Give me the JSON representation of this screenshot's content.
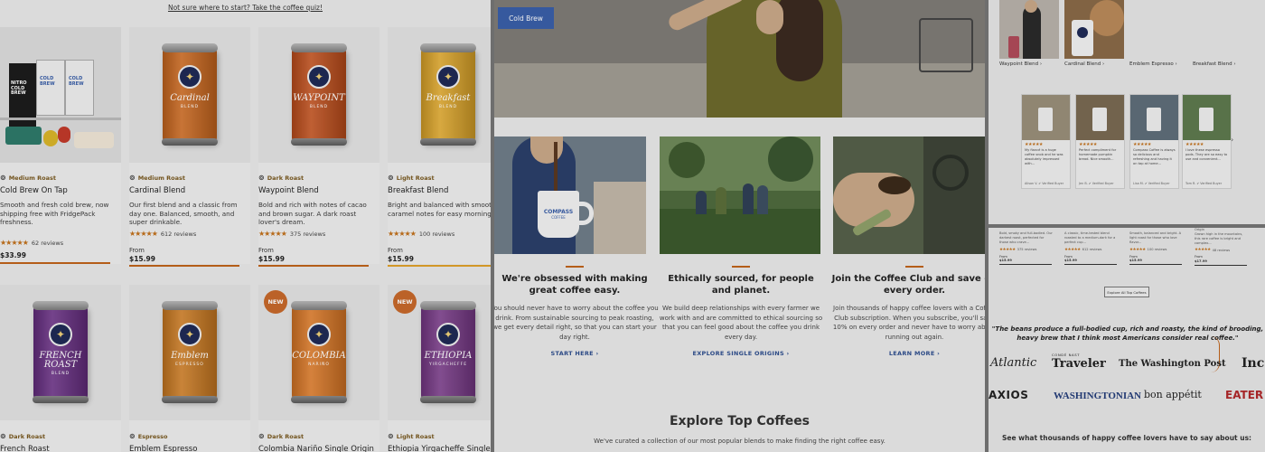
{
  "panel1": {
    "quiz_link": "Not sure where to start? Take the coffee quiz!",
    "row1": [
      {
        "roast": "Medium Roast",
        "name": "Cold Brew On Tap",
        "desc": "Smooth and fresh cold brew, now shipping free with FridgePack freshness.",
        "reviews": "62 reviews",
        "from": "",
        "price": "$33.99",
        "can_color": "#d97b28",
        "can_word": ""
      },
      {
        "roast": "Medium Roast",
        "name": "Cardinal Blend",
        "desc": "Our first blend and a classic from day one. Balanced, smooth, and super drinkable.",
        "reviews": "612 reviews",
        "from": "From",
        "price": "$15.99",
        "can_color": "#cf6a1f",
        "can_word": "Cardinal",
        "can_sub": "BLEND"
      },
      {
        "roast": "Dark Roast",
        "name": "Waypoint Blend",
        "desc": "Bold and rich with notes of cacao and brown sugar. A dark roast lover's dream.",
        "reviews": "375 reviews",
        "from": "From",
        "price": "$15.99",
        "can_color": "#c4501c",
        "can_word": "WAYPOINT",
        "can_sub": "BLEND"
      },
      {
        "roast": "Light Roast",
        "name": "Breakfast Blend",
        "desc": "Bright and balanced with smooth caramel notes for easy mornings.",
        "reviews": "100 reviews",
        "from": "From",
        "price": "$15.99",
        "can_color": "#e2a92a",
        "can_word": "Breakfast",
        "can_sub": "BLEND"
      }
    ],
    "row2": [
      {
        "roast": "Dark Roast",
        "name": "French Roast",
        "can_color": "#6a2f86",
        "can_word": "FRENCH ROAST",
        "can_sub": "BLEND",
        "new": false
      },
      {
        "roast": "Espresso",
        "name": "Emblem Espresso",
        "can_color": "#d07d22",
        "can_word": "Emblem",
        "can_sub": "ESPRESSO",
        "new": false
      },
      {
        "roast": "Dark Roast",
        "name": "Colombia Nariño Single Origin",
        "can_color": "#df7a26",
        "can_word": "COLOMBIA",
        "can_sub": "NARIÑO",
        "new": true
      },
      {
        "roast": "Light Roast",
        "name": "Ethiopia Yirgacheffe Single",
        "can_color": "#7a3a8a",
        "can_word": "ETHIOPIA",
        "can_sub": "YIRGACHEFFE",
        "new": true
      }
    ],
    "new_label": "NEW",
    "cold_brew_box_text": "NITRO COLD BREW",
    "cold_brew_box_text2": "COLD BREW"
  },
  "panel2": {
    "hero_button": "Cold Brew",
    "mug_text": "COMPASS",
    "mug_sub": "COFFEE",
    "columns": [
      {
        "title": "We're obsessed with making great coffee easy.",
        "body": "You should never have to worry about the coffee you drink. From sustainable sourcing to peak roasting, we get every detail right, so that you can start your day right.",
        "link": "START HERE ›"
      },
      {
        "title": "Ethically sourced, for people and planet.",
        "body": "We build deep relationships with every farmer we work with and are committed to ethical sourcing so that you can feel good about the coffee you drink every day.",
        "link": "EXPLORE SINGLE ORIGINS ›"
      },
      {
        "title": "Join the Coffee Club and save on every order.",
        "body": "Join thousands of happy coffee lovers with a Coffee Club subscription. When you subscribe, you'll save 10% on every order and never have to worry about running out again.",
        "link": "LEARN MORE ›"
      }
    ],
    "explore_title": "Explore Top Coffees",
    "explore_sub": "We've curated a collection of our most popular blends to make finding the right coffee easy."
  },
  "panel3": {
    "ig_labels": [
      "Waypoint Blend ›",
      "Cardinal Blend ›",
      "Emblem Espresso ›",
      "Breakfast Blend ›"
    ],
    "reviews": [
      {
        "stars": "★★★★★",
        "text": "My fiancé is a huge coffee snob and he was absolutely impressed with..."
      },
      {
        "stars": "★★★★★",
        "text": "Perfect compliment for homemade pumpkin bread. Nice smooth..."
      },
      {
        "stars": "★★★★★",
        "text": "Compass Coffee is always so delicious and refreshing and having it on tap at home..."
      },
      {
        "stars": "★★★★★",
        "text": "I love these espresso pods. They are so easy to use and convenient..."
      }
    ],
    "reviewer": [
      "Alison V. ✔ Verified Buyer",
      "Jen B. ✔ Verified Buyer",
      "Lisa M. ✔ Verified Buyer",
      "Tom R. ✔ Verified Buyer"
    ]
  },
  "panel4": {
    "mini_cards": [
      {
        "text": "Bold, smoky and full-bodied. Our darkest roast, perfected for those who crave...",
        "reviews": "375 reviews",
        "from": "From",
        "price": "$15.99"
      },
      {
        "text": "A classic, time-tested blend roasted to a medium-dark for a perfect cup...",
        "reviews": "612 reviews",
        "from": "From",
        "price": "$15.99"
      },
      {
        "text": "Smooth, balanced and bright. A light roast for those who love flavor...",
        "reviews": "100 reviews",
        "from": "From",
        "price": "$15.99"
      },
      {
        "text": "Grown high in the mountains, this rare coffee is bright and complex...",
        "reviews": "48 reviews",
        "from": "From",
        "price": "$17.99",
        "label": "Origin"
      }
    ],
    "explore_btn": "Explore All Top Coffees",
    "quote": "\"The beans produce a full-bodied cup, rich and roasty, the kind of brooding, heavy brew that I think most Americans consider real coffee.\"",
    "logos": [
      "Atlantic",
      "Traveler",
      "The Washington Post",
      "Inc.",
      "AXIOS",
      "WASHINGTONIAN",
      "bon appétit",
      "EATER"
    ],
    "traveler_kicker": "CONDÉ NAST",
    "see_what": "See what thousands of happy coffee lovers have to say about us:"
  },
  "colors": {
    "accent": "#c0631a",
    "link": "#2f4f8f",
    "star": "#c2701a",
    "button": "#3a5fa8"
  }
}
